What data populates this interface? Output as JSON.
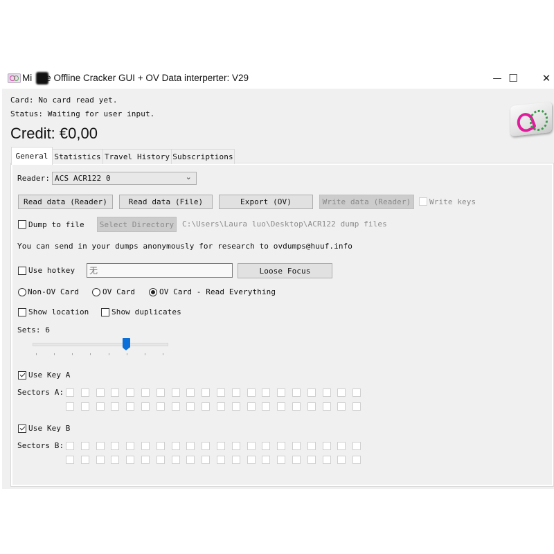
{
  "window": {
    "title_prefix": "Mi",
    "title_suffix": "e Offline Cracker GUI + OV Data interperter: V29",
    "controls": {
      "minimize": "—",
      "maximize": "☐",
      "close": "✕"
    }
  },
  "header": {
    "card_text": "Card: No card read yet.",
    "status_text": "Status: Waiting for user input.",
    "credit_text": "Credit: €0,00",
    "logo_icon": "ov-chipkaart-logo-icon"
  },
  "tabs": [
    {
      "label": "General",
      "active": true
    },
    {
      "label": "Statistics",
      "active": false
    },
    {
      "label": "Travel History",
      "active": false
    },
    {
      "label": "Subscriptions",
      "active": false
    }
  ],
  "general": {
    "reader_label": "Reader:",
    "reader_value": "ACS ACR122 0",
    "buttons": {
      "read_reader": "Read data (Reader)",
      "read_file": "Read data (File)",
      "export_ov": "Export (OV)",
      "write_reader": "Write data (Reader)"
    },
    "write_keys_label": "Write keys",
    "write_keys_checked": false,
    "dump_to_file_label": "Dump to file",
    "dump_to_file_checked": false,
    "select_directory_label": "Select Directory",
    "directory_path": "C:\\Users\\Laura luo\\Desktop\\ACR122 dump files",
    "info_text": "You can send in your dumps anonymously for research to ovdumps@huuf.info",
    "use_hotkey_label": "Use hotkey",
    "use_hotkey_checked": false,
    "hotkey_value": "无",
    "loose_focus_label": "Loose Focus",
    "card_mode": {
      "options": [
        "Non-OV Card",
        "OV Card",
        "OV Card - Read Everything"
      ],
      "selected": "OV Card - Read Everything"
    },
    "show_location_label": "Show location",
    "show_location_checked": false,
    "show_duplicates_label": "Show duplicates",
    "show_duplicates_checked": false,
    "sets_label": "Sets: 6",
    "sets_slider": {
      "min": 1,
      "max": 8,
      "value": 6
    },
    "use_key_a_label": "Use Key A",
    "use_key_a_checked": true,
    "sectors_a_label": "Sectors A:",
    "sectors_a_count": 40,
    "sectors_a_checked": [],
    "use_key_b_label": "Use Key B",
    "use_key_b_checked": true,
    "sectors_b_label": "Sectors B:",
    "sectors_b_count": 40,
    "sectors_b_checked": []
  }
}
